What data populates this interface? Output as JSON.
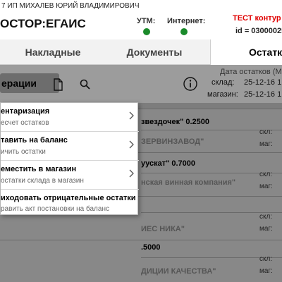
{
  "window": {
    "title": "7 ИП МИХАЛЕВ ЮРИЙ ВЛАДИМИРОВИЧ"
  },
  "header": {
    "app_name": "ОСТОР:ЕГАИС",
    "utm_label": "УТМ:",
    "internet_label": "Интернет:",
    "test_label": "ТЕСТ контур",
    "id_label": "id = 03000025",
    "status_color": "#1a8a2a"
  },
  "tabs": [
    {
      "label": "Накладные",
      "active": false
    },
    {
      "label": "Документы",
      "active": false
    },
    {
      "label": "Остатк",
      "active": true
    }
  ],
  "toolbar": {
    "operations_label": "ерации",
    "document_icon": "document-icon",
    "search_icon": "search-icon",
    "info_icon": "info-icon",
    "date_caption": "Дата остатков (М",
    "warehouse_label": "склад:",
    "warehouse_date": "25-12-16 1",
    "store_label": "магазин:",
    "store_date": "25-12-16 1"
  },
  "cards": [
    {
      "title": "звездочек\" 0.2500",
      "subtitle": "ЗЕРВИНЗАВОД\"",
      "skl": "скл:",
      "mag": "маг:"
    },
    {
      "title": "уускат\" 0.7000",
      "subtitle": "нская винная компания\"",
      "skl": "скл:",
      "mag": "маг:"
    },
    {
      "title": "",
      "subtitle": "ИЕС НИКА\"",
      "skl": "скл:",
      "mag": "маг:"
    },
    {
      "title": ".5000",
      "subtitle": "ДИЦИИ КАЧЕСТВА\"",
      "skl": "скл:",
      "mag": "маг:"
    }
  ],
  "menu": {
    "items": [
      {
        "title": "ентаризация",
        "desc": "есчет остатков",
        "chevron": true
      },
      {
        "title": "тавить на баланс",
        "desc": "ичить остатки",
        "chevron": true
      },
      {
        "title": "еместить в магазин",
        "desc": "остатки склада в магазин",
        "chevron": true
      },
      {
        "title": "иходовать отрицательные остатки",
        "desc": "равить акт постановки на баланс",
        "chevron": false
      }
    ]
  }
}
